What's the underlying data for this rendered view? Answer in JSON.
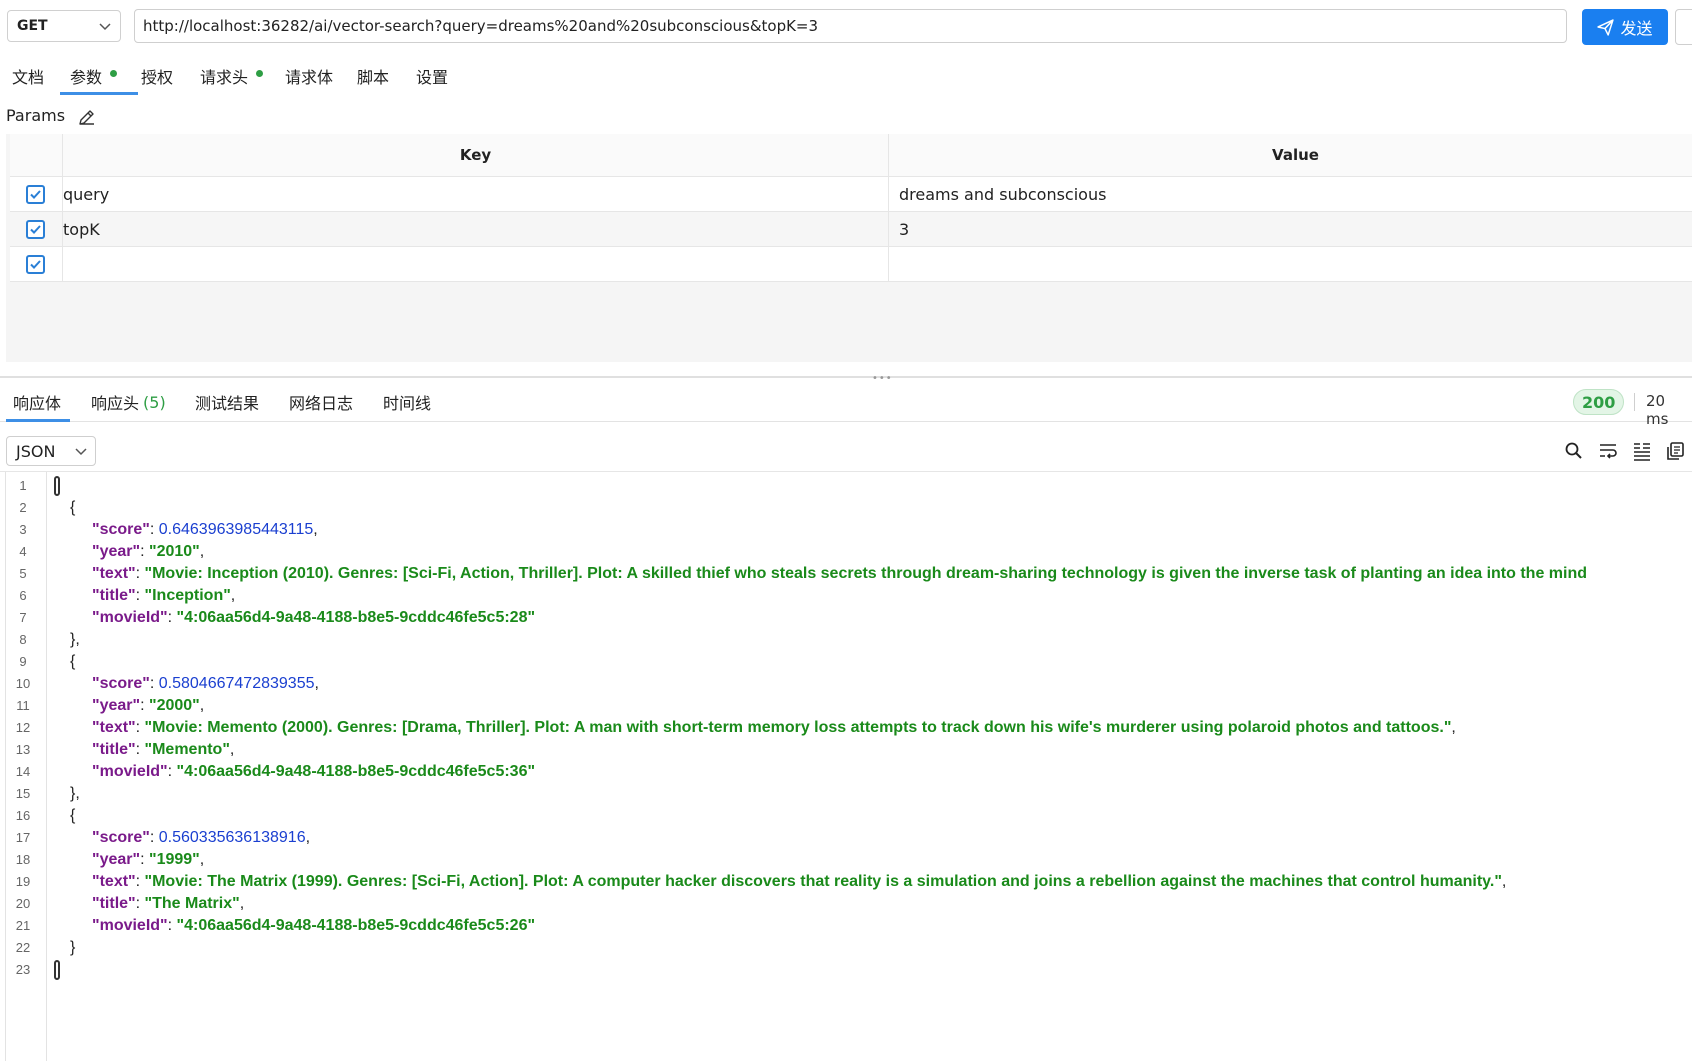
{
  "request": {
    "method": "GET",
    "url": "http://localhost:36282/ai/vector-search?query=dreams%20and%20subconscious&topK=3",
    "send_label": "发送"
  },
  "request_tabs": [
    {
      "label": "文档",
      "dot": false
    },
    {
      "label": "参数",
      "dot": true,
      "active": true
    },
    {
      "label": "授权",
      "dot": false
    },
    {
      "label": "请求头",
      "dot": true
    },
    {
      "label": "请求体",
      "dot": false
    },
    {
      "label": "脚本",
      "dot": false
    },
    {
      "label": "设置",
      "dot": false
    }
  ],
  "params": {
    "label": "Params",
    "headers": {
      "key": "Key",
      "value": "Value"
    },
    "rows": [
      {
        "key": "query",
        "value": "dreams and subconscious",
        "checked": true
      },
      {
        "key": "topK",
        "value": "3",
        "checked": true
      },
      {
        "key": "",
        "value": "",
        "checked": true
      }
    ]
  },
  "response_tabs": [
    {
      "label": "响应体",
      "active": true
    },
    {
      "label": "响应头",
      "count": "(5)"
    },
    {
      "label": "测试结果"
    },
    {
      "label": "网络日志"
    },
    {
      "label": "时间线"
    }
  ],
  "response_status": {
    "code": "200",
    "time": "20 ms",
    "status_color": "#2e9e44"
  },
  "response_format": "JSON",
  "accent_color": "#1a7ff0",
  "line_numbers": [
    "1",
    "2",
    "3",
    "4",
    "5",
    "6",
    "7",
    "8",
    "9",
    "10",
    "11",
    "12",
    "13",
    "14",
    "15",
    "16",
    "17",
    "18",
    "19",
    "20",
    "21",
    "22",
    "23"
  ],
  "results": [
    {
      "score": "0.6463963985443115",
      "year": "\"2010\"",
      "text": "\"Movie: Inception (2010). Genres: [Sci-Fi, Action, Thriller]. Plot: A skilled thief who steals secrets through dream-sharing technology is given the inverse task of planting an idea into the mind",
      "text_trail": "",
      "title": "\"Inception\"",
      "movieId": "\"4:06aa56d4-9a48-4188-b8e5-9cddc46fe5c5:28\""
    },
    {
      "score": "0.5804667472839355",
      "year": "\"2000\"",
      "text": "\"Movie: Memento (2000). Genres: [Drama, Thriller]. Plot: A man with short-term memory loss attempts to track down his wife's murderer using polaroid photos and tattoos.\"",
      "text_trail": ",",
      "title": "\"Memento\"",
      "movieId": "\"4:06aa56d4-9a48-4188-b8e5-9cddc46fe5c5:36\""
    },
    {
      "score": "0.560335636138916",
      "year": "\"1999\"",
      "text": "\"Movie: The Matrix (1999). Genres: [Sci-Fi, Action]. Plot: A computer hacker discovers that reality is a simulation and joins a rebellion against the machines that control humanity.\"",
      "text_trail": ",",
      "title": "\"The Matrix\"",
      "movieId": "\"4:06aa56d4-9a48-4188-b8e5-9cddc46fe5c5:26\""
    }
  ],
  "json_keys": {
    "score": "\"score\"",
    "year": "\"year\"",
    "text": "\"text\"",
    "title": "\"title\"",
    "movieId": "\"movieId\""
  },
  "punct": {
    "open": "{",
    "close": "}",
    "close_comma": "},",
    "colon": ": ",
    "comma": ","
  }
}
